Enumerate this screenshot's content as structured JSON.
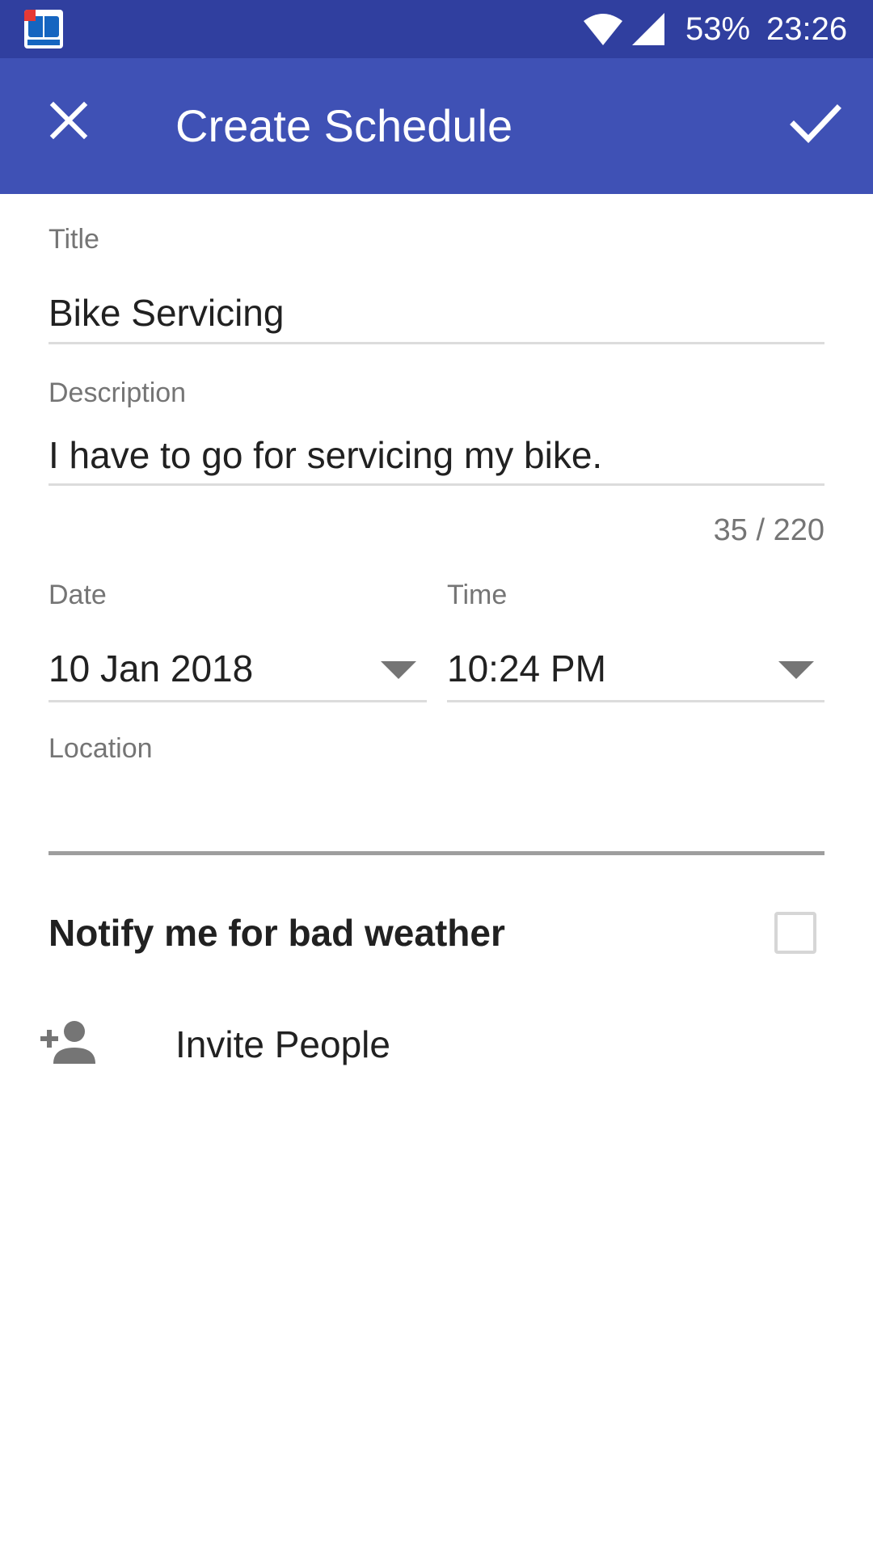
{
  "status_bar": {
    "battery": "53%",
    "time": "23:26"
  },
  "app_bar": {
    "title": "Create Schedule",
    "close_icon": "close-icon",
    "confirm_icon": "check-icon",
    "color": "#3f51b5",
    "status_color": "#303f9f"
  },
  "form": {
    "title": {
      "label": "Title",
      "value": "Bike Servicing"
    },
    "description": {
      "label": "Description",
      "value": "I have to go for servicing my bike.",
      "counter": "35 / 220"
    },
    "date": {
      "label": "Date",
      "value": "10 Jan 2018"
    },
    "time": {
      "label": "Time",
      "value": "10:24 PM"
    },
    "location": {
      "label": "Location",
      "value": ""
    },
    "weather": {
      "label": "Notify me for bad weather",
      "checked": false
    },
    "invite": {
      "label": "Invite People",
      "icon": "person-add-icon"
    }
  }
}
